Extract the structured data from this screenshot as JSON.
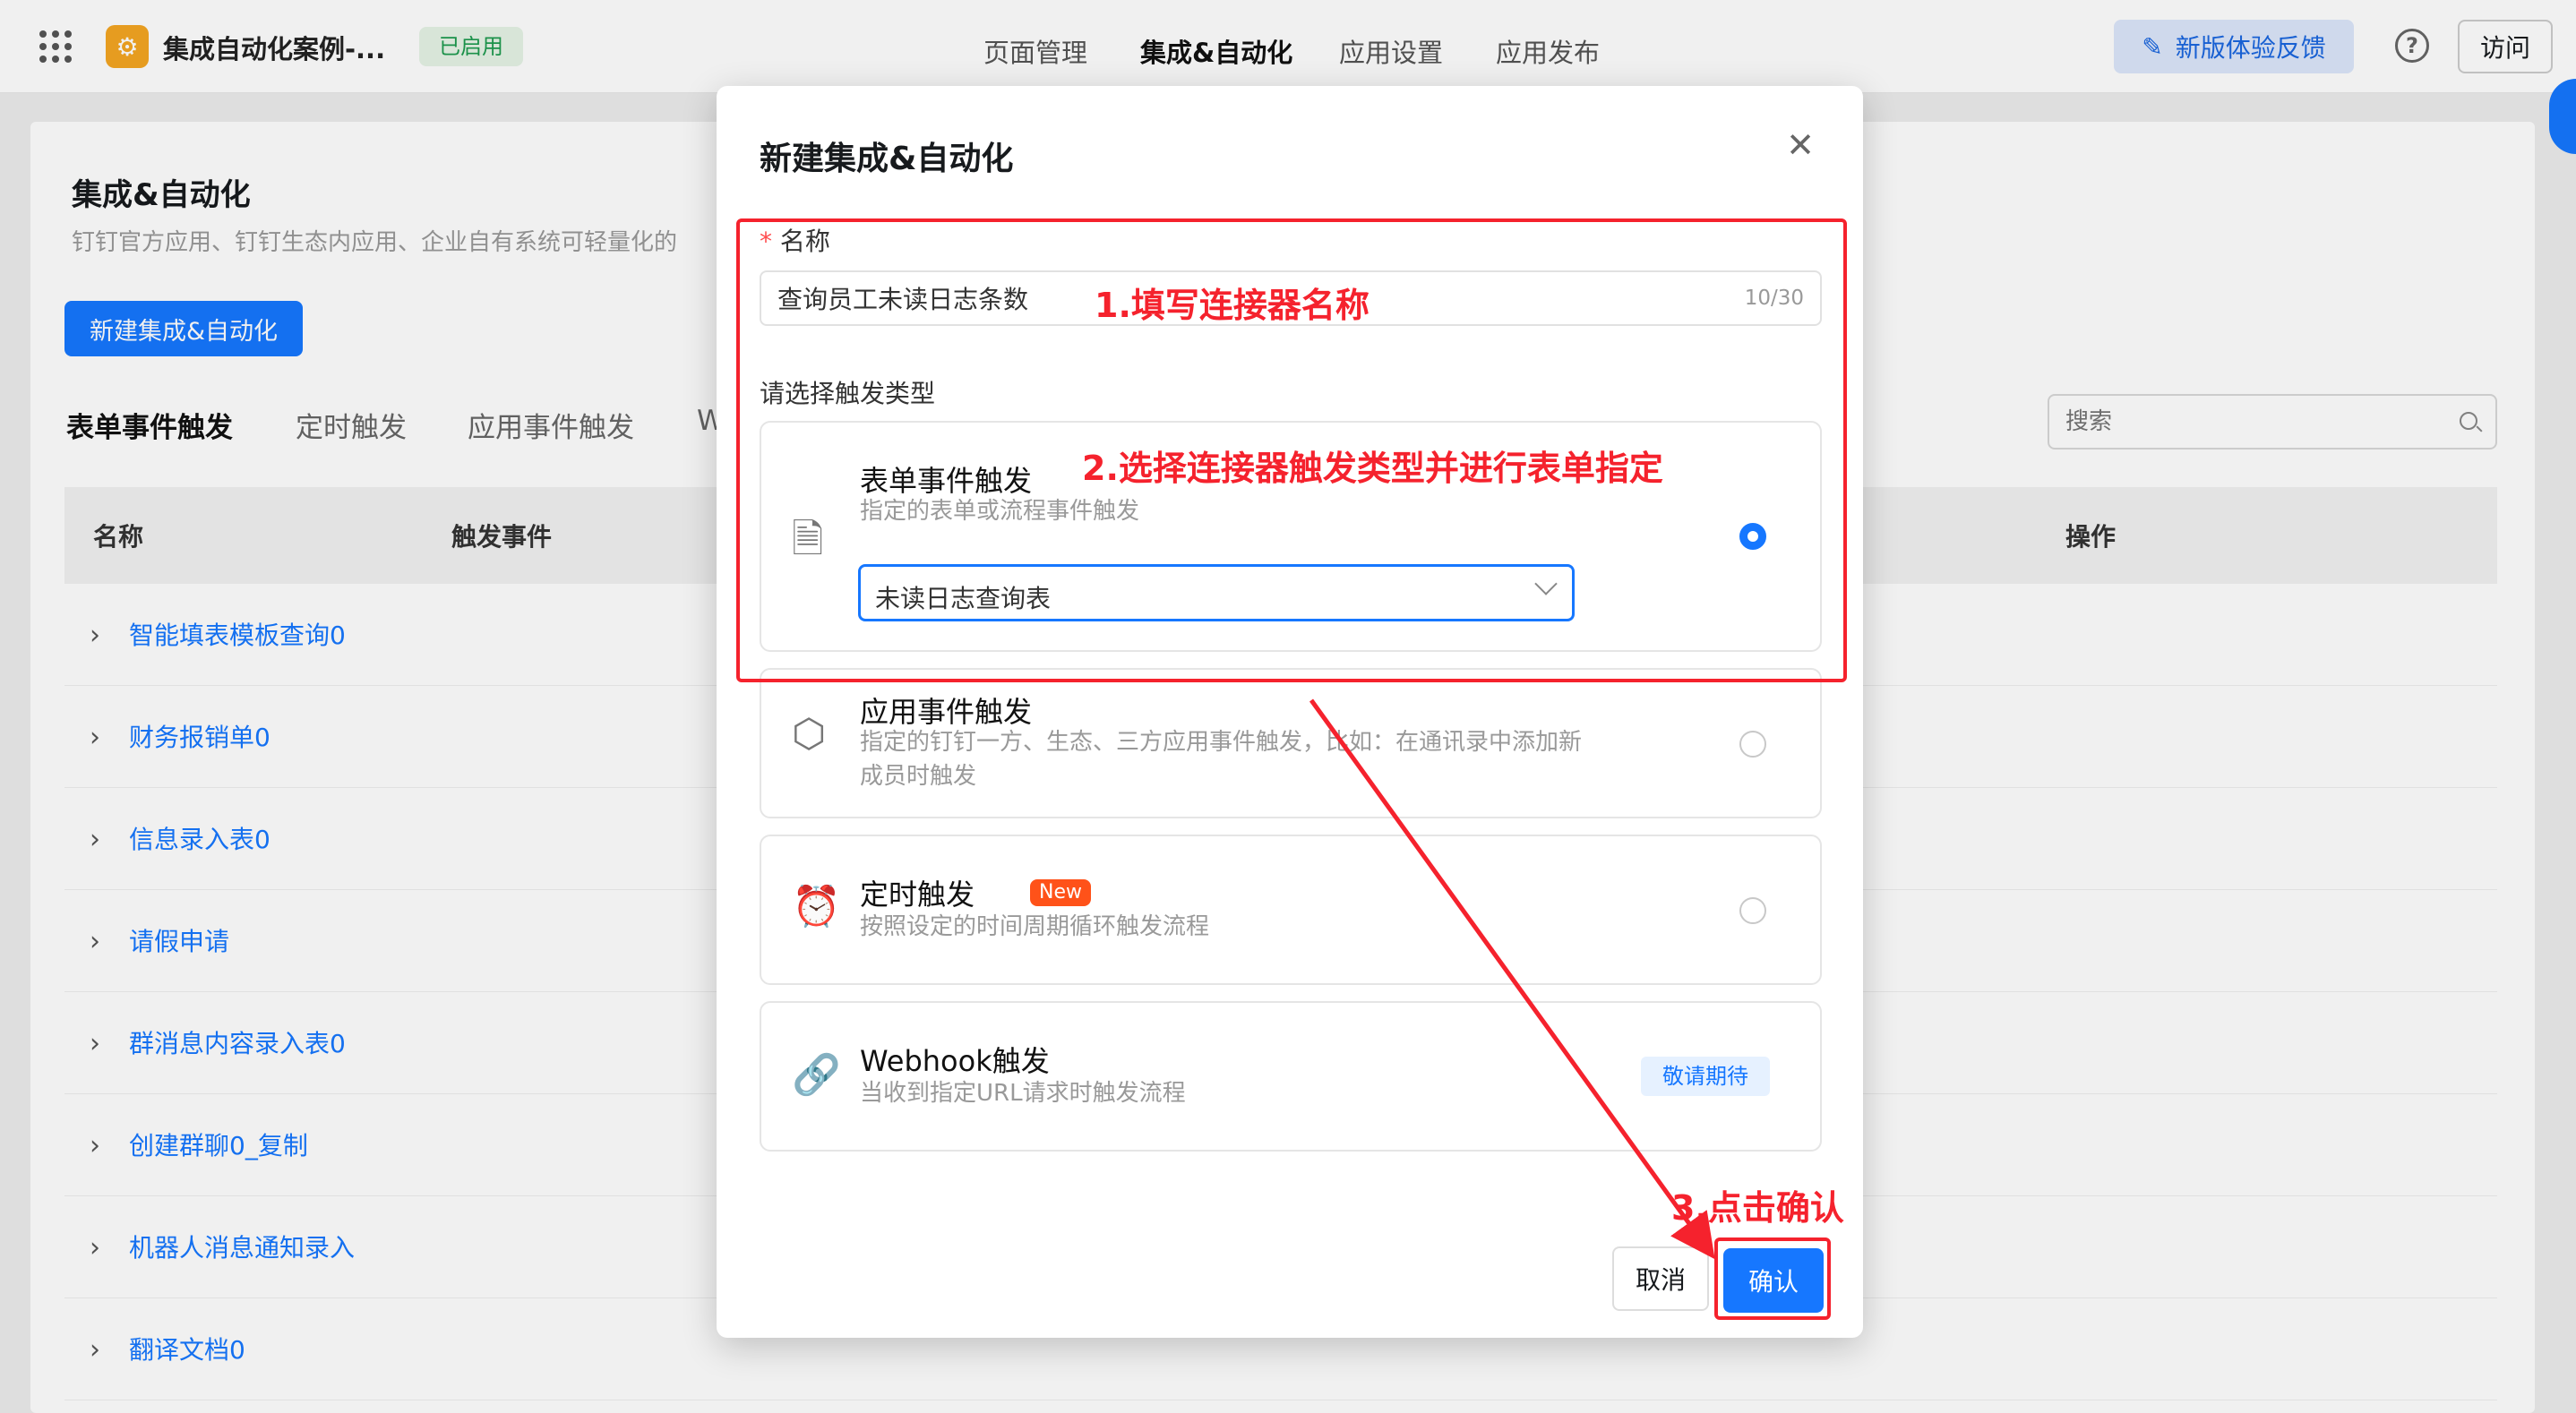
{
  "topbar": {
    "app_name": "集成自动化案例-...",
    "status": "已启用",
    "tabs": [
      "页面管理",
      "集成&自动化",
      "应用设置",
      "应用发布"
    ],
    "feedback": "新版体验反馈",
    "help": "?",
    "visit": "访问"
  },
  "page": {
    "title": "集成&自动化",
    "desc": "钉钉官方应用、钉钉生态内应用、企业自有系统可轻量化的",
    "new_button": "新建集成&自动化",
    "filter_tabs": [
      "表单事件触发",
      "定时触发",
      "应用事件触发",
      "W"
    ],
    "search_placeholder": "搜索",
    "columns": [
      "名称",
      "触发事件",
      "操作"
    ],
    "rows": [
      "智能填表模板查询0",
      "财务报销单0",
      "信息录入表0",
      "请假申请",
      "群消息内容录入表0",
      "创建群聊0_复制",
      "机器人消息通知录入",
      "翻译文档0"
    ]
  },
  "modal": {
    "title": "新建集成&自动化",
    "name_label": "名称",
    "required_mark": "*",
    "name_value": "查询员工未读日志条数",
    "name_counter": "10/30",
    "trigger_label": "请选择触发类型",
    "options": [
      {
        "title": "表单事件触发",
        "desc": "指定的表单或流程事件触发",
        "selected_form": "未读日志查询表"
      },
      {
        "title": "应用事件触发",
        "desc": "指定的钉钉一方、生态、三方应用事件触发，比如：在通讯录中添加新成员时触发"
      },
      {
        "title": "定时触发",
        "badge": "New",
        "desc": "按照设定的时间周期循环触发流程"
      },
      {
        "title": "Webhook触发",
        "desc": "当收到指定URL请求时触发流程",
        "badge": "敬请期待"
      }
    ],
    "cancel": "取消",
    "confirm": "确认"
  },
  "annotations": {
    "step1": "1.填写连接器名称",
    "step2": "2.选择连接器触发类型并进行表单指定",
    "step3": "3.点击确认"
  },
  "colors": {
    "primary": "#1677ff",
    "annotation": "#f5222d"
  }
}
